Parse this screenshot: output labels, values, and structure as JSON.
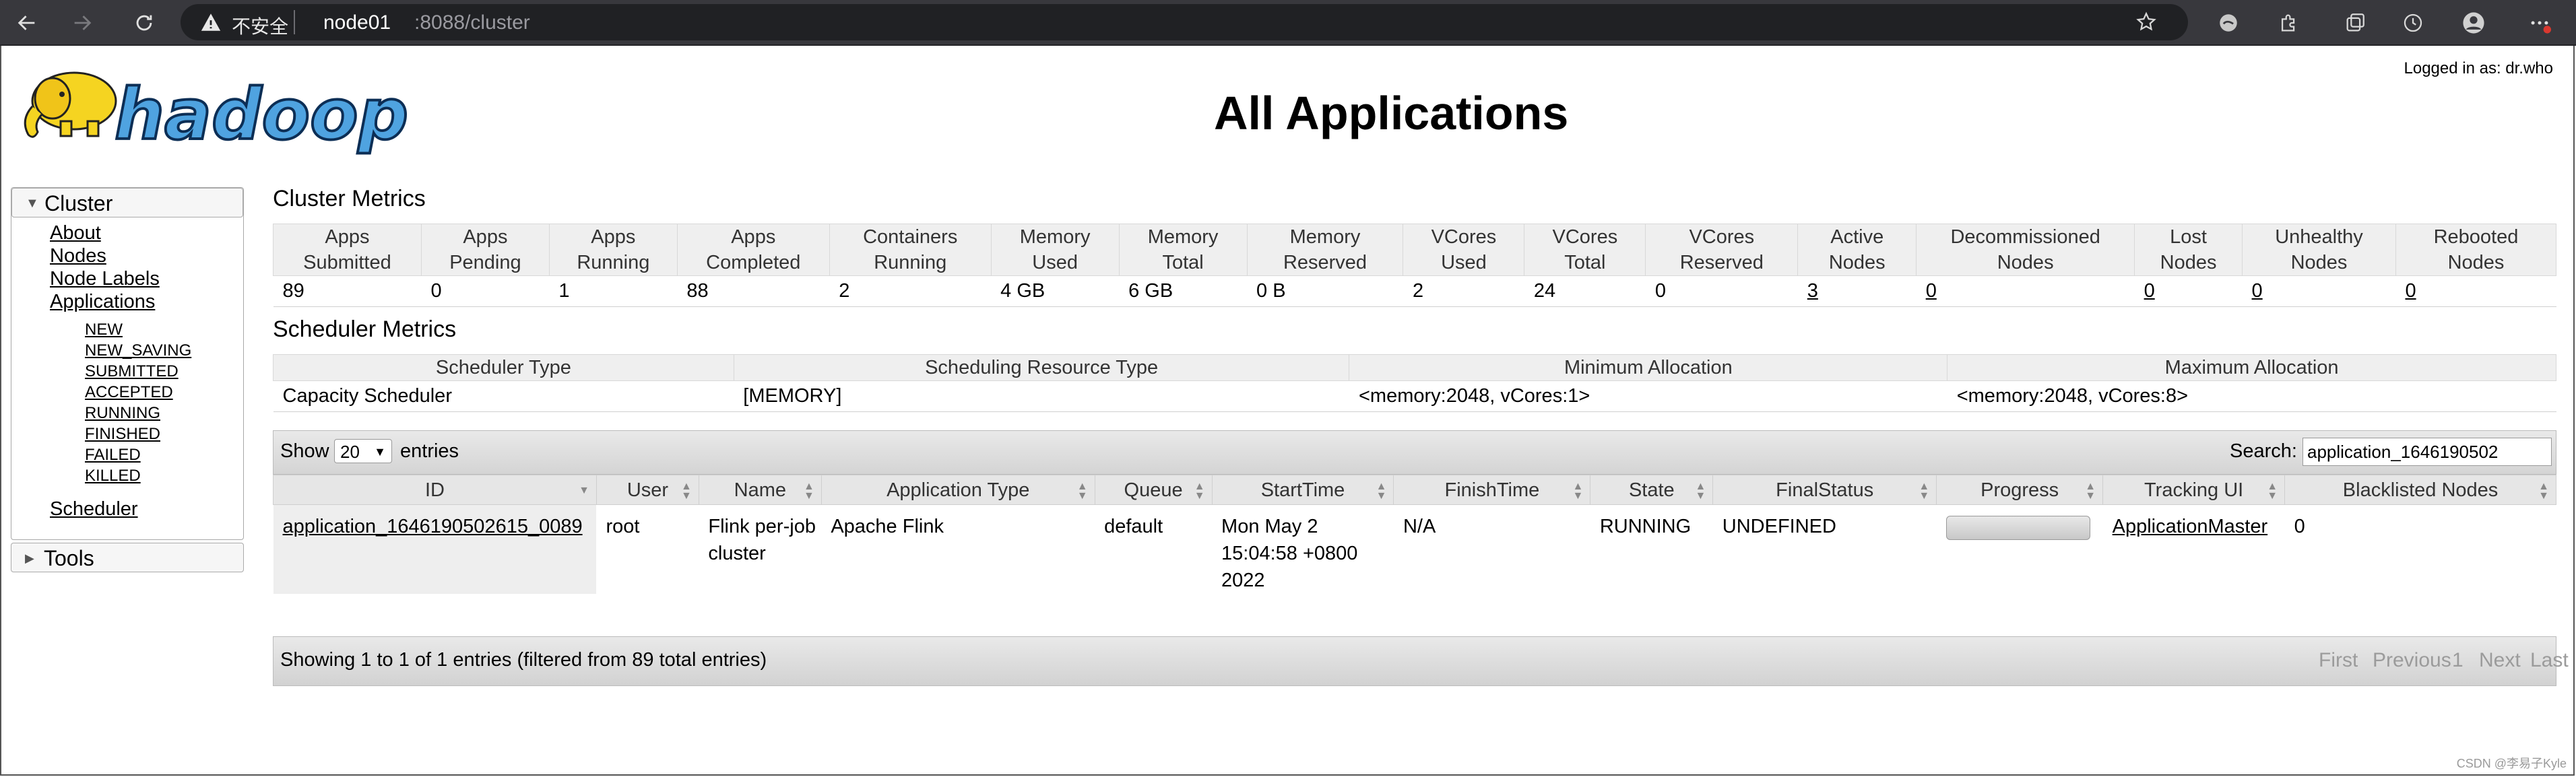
{
  "browser": {
    "insecure_label": "不安全",
    "url_host": "node01",
    "url_path": ":8088/cluster"
  },
  "header": {
    "logo_text": "hadoop",
    "logged_in": "Logged in as: dr.who",
    "title": "All Applications"
  },
  "nav": {
    "cluster_label": "Cluster",
    "cluster_items": [
      "About",
      "Nodes",
      "Node Labels",
      "Applications"
    ],
    "app_states": [
      "NEW",
      "NEW_SAVING",
      "SUBMITTED",
      "ACCEPTED",
      "RUNNING",
      "FINISHED",
      "FAILED",
      "KILLED"
    ],
    "scheduler_label": "Scheduler",
    "tools_label": "Tools"
  },
  "cluster_metrics": {
    "title": "Cluster Metrics",
    "headers": [
      [
        "Apps",
        "Submitted"
      ],
      [
        "Apps",
        "Pending"
      ],
      [
        "Apps",
        "Running"
      ],
      [
        "Apps",
        "Completed"
      ],
      [
        "Containers",
        "Running"
      ],
      [
        "Memory",
        "Used"
      ],
      [
        "Memory",
        "Total"
      ],
      [
        "Memory",
        "Reserved"
      ],
      [
        "VCores",
        "Used"
      ],
      [
        "VCores",
        "Total"
      ],
      [
        "VCores",
        "Reserved"
      ],
      [
        "Active",
        "Nodes"
      ],
      [
        "Decommissioned",
        "Nodes"
      ],
      [
        "Lost",
        "Nodes"
      ],
      [
        "Unhealthy",
        "Nodes"
      ],
      [
        "Rebooted",
        "Nodes"
      ]
    ],
    "values": [
      "89",
      "0",
      "1",
      "88",
      "2",
      "4 GB",
      "6 GB",
      "0 B",
      "2",
      "24",
      "0",
      "3",
      "0",
      "0",
      "0",
      "0"
    ]
  },
  "scheduler_metrics": {
    "title": "Scheduler Metrics",
    "headers": [
      "Scheduler Type",
      "Scheduling Resource Type",
      "Minimum Allocation",
      "Maximum Allocation"
    ],
    "values": [
      "Capacity Scheduler",
      "[MEMORY]",
      "<memory:2048, vCores:1>",
      "<memory:2048, vCores:8>"
    ]
  },
  "apps_table": {
    "show_label": "Show",
    "page_size": "20",
    "entries_label": "entries",
    "search_label": "Search:",
    "search_value": "application_1646190502",
    "headers": [
      "ID",
      "User",
      "Name",
      "Application Type",
      "Queue",
      "StartTime",
      "FinishTime",
      "State",
      "FinalStatus",
      "Progress",
      "Tracking UI",
      "Blacklisted Nodes"
    ],
    "rows": [
      {
        "id": "application_1646190502615_0089",
        "user": "root",
        "name": "Flink per-job cluster",
        "type": "Apache Flink",
        "queue": "default",
        "start": "Mon May 2 15:04:58 +0800 2022",
        "finish": "N/A",
        "state": "RUNNING",
        "final_status": "UNDEFINED",
        "progress": 0,
        "tracking_ui": "ApplicationMaster",
        "blacklisted": "0"
      }
    ],
    "info": "Showing 1 to 1 of 1 entries (filtered from 89 total entries)",
    "pager": [
      "First",
      "Previous",
      "1",
      "Next",
      "Last"
    ]
  },
  "watermark": "CSDN @李易子Kyle"
}
